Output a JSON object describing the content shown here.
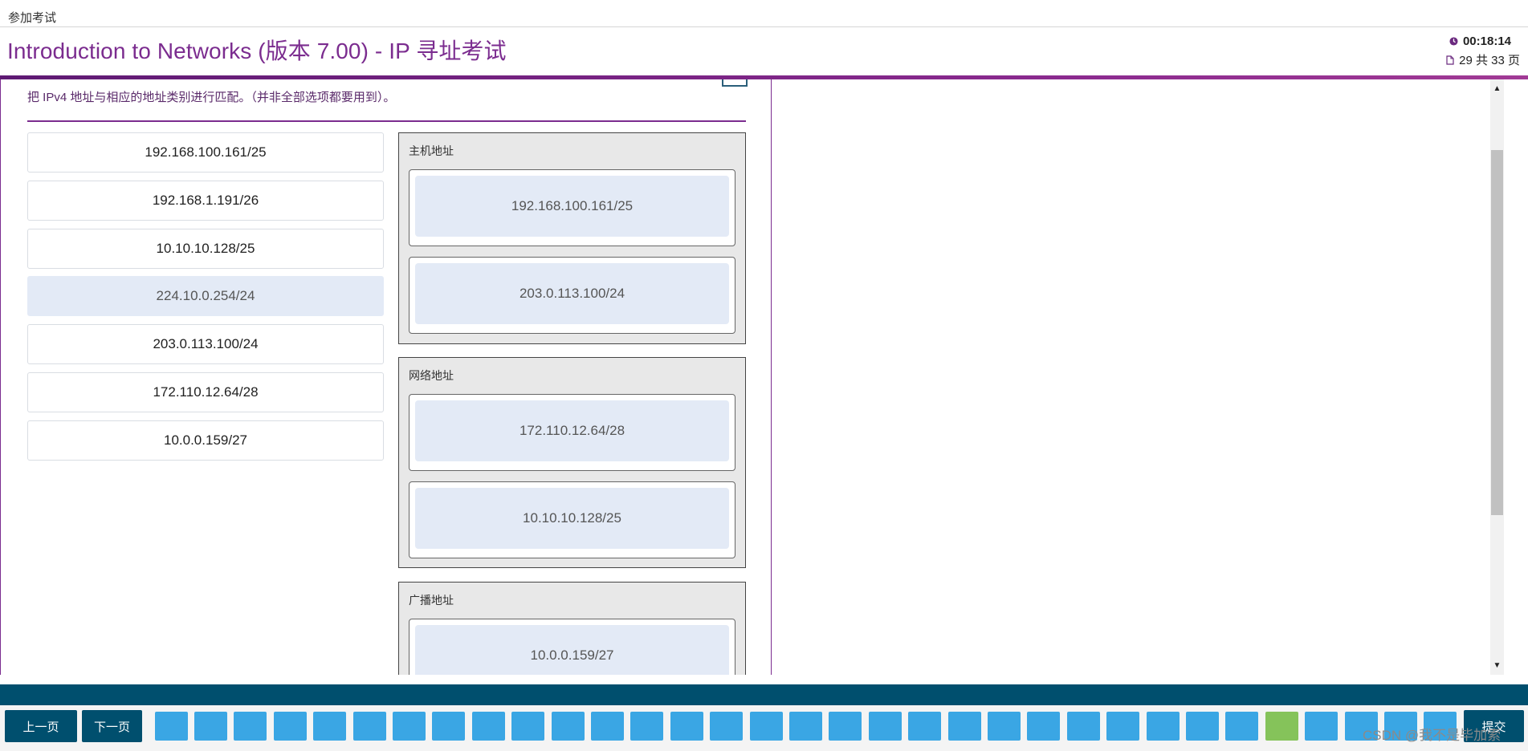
{
  "window": {
    "label": "参加考试"
  },
  "header": {
    "title": "Introduction to Networks (版本 7.00) - IP 寻址考试",
    "timer": "00:18:14",
    "page_count": "29 共 33 页",
    "timer_icon": "clock-icon",
    "page_icon": "document-icon"
  },
  "question": {
    "instruction": "把 IPv4 地址与相应的地址类别进行匹配。（并非全部选项都要用到）。",
    "options": [
      "192.168.100.161/25",
      "192.168.1.191/26",
      "10.10.10.128/25",
      "224.10.0.254/24",
      "203.0.113.100/24",
      "172.110.12.64/28",
      "10.0.0.159/27"
    ],
    "categories": [
      {
        "label": "主机地址",
        "items": [
          "192.168.100.161/25",
          "203.0.113.100/24"
        ]
      },
      {
        "label": "网络地址",
        "items": [
          "172.110.12.64/28",
          "10.10.10.128/25"
        ]
      },
      {
        "label": "广播地址",
        "items": [
          "10.0.0.159/27"
        ]
      }
    ]
  },
  "footer": {
    "prev_label": "上一页",
    "next_label": "下一页",
    "submit_label": "提交",
    "answered_color": "#85c35a",
    "unanswered_color": "#3aa6e4"
  },
  "watermark": "CSDN @我不是毕加索"
}
